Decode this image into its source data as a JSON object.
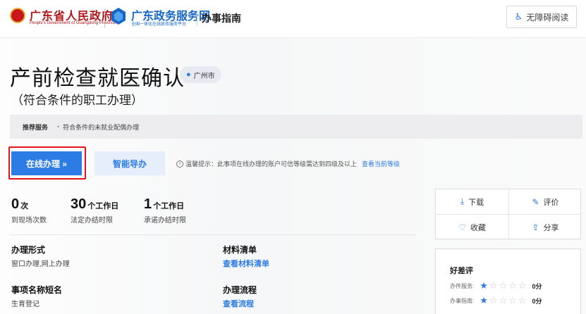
{
  "header": {
    "gov_title": "广东省人民政府",
    "gov_subtitle": "People's Government of Guangdong Province",
    "portal_title": "广东政务服务网",
    "portal_subtitle": "全国一体化在线政务服务平台",
    "section_title": "办事指南",
    "accessibility_label": "无障碍阅读"
  },
  "item": {
    "title": "产前检查就医确认",
    "city": "广州市",
    "subtitle": "（符合条件的职工办理）"
  },
  "service_bar": {
    "label": "推荐服务",
    "item": "符合条件的未就业配偶办理"
  },
  "buttons": {
    "online": "在线办理 »",
    "smart": "智能导办"
  },
  "tip": {
    "text": "温馨提示：此事项在线办理的账户可信等级需达到四级及以上",
    "link": "查看当前等级"
  },
  "stats": [
    {
      "num": "0",
      "unit": "次",
      "label": "到现场次数"
    },
    {
      "num": "30",
      "unit": "个工作日",
      "label": "法定办结时限"
    },
    {
      "num": "1",
      "unit": "个工作日",
      "label": "承诺办结时限"
    }
  ],
  "info": {
    "mode_title": "办理形式",
    "mode_value": "窗口办理,网上办理",
    "materials_title": "材料清单",
    "materials_link": "查看材料清单",
    "short_name_title": "事项名称短名",
    "short_name_value": "生育登记",
    "process_title": "办理流程",
    "process_link": "查看流程"
  },
  "actions": {
    "download": "下载",
    "review": "评价",
    "favorite": "收藏",
    "share": "分享"
  },
  "rating": {
    "title": "好差评",
    "service_label": "办件服务:",
    "service_score": "0分",
    "service_stars": 1,
    "guide_label": "办事指南:",
    "guide_score": "0分",
    "guide_stars": 1
  },
  "colors": {
    "accent": "#2d7be5",
    "gov_red": "#b2151a",
    "highlight_border": "#e3141b"
  }
}
